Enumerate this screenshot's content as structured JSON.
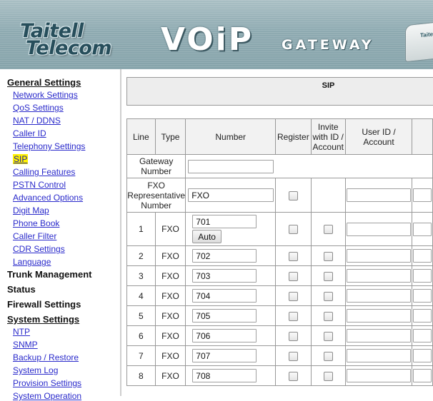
{
  "banner": {
    "logo_line1": "Taitell",
    "logo_line2": "Telecom",
    "product_voip": "VOiP",
    "product_gateway": "GATEWAY",
    "device_label": "Taitell"
  },
  "sidebar": {
    "general_settings": "General Settings",
    "general_items": [
      {
        "label": "Network Settings"
      },
      {
        "label": "QoS Settings"
      },
      {
        "label": "NAT / DDNS"
      },
      {
        "label": "Caller ID"
      },
      {
        "label": "Telephony Settings"
      },
      {
        "label": "SIP",
        "active": true
      },
      {
        "label": "Calling Features"
      },
      {
        "label": "PSTN Control"
      },
      {
        "label": "Advanced Options"
      },
      {
        "label": "Digit Map"
      },
      {
        "label": "Phone Book"
      },
      {
        "label": "Caller Filter"
      },
      {
        "label": "CDR Settings"
      },
      {
        "label": "Language"
      }
    ],
    "trunk_management": "Trunk Management",
    "status": "Status",
    "firewall_settings": "Firewall Settings",
    "system_settings": "System Settings",
    "system_items": [
      {
        "label": "NTP"
      },
      {
        "label": "SNMP"
      },
      {
        "label": "Backup / Restore"
      },
      {
        "label": "System Log"
      },
      {
        "label": "Provision Settings"
      },
      {
        "label": "System Operation"
      }
    ]
  },
  "main": {
    "section_title": "SIP",
    "table": {
      "headers": {
        "line": "Line",
        "type": "Type",
        "number": "Number",
        "register": "Register",
        "invite_line1": "Invite",
        "invite_line2": "with ID /",
        "invite_line3": "Account",
        "userid_line1": "User ID /",
        "userid_line2": "Account"
      },
      "gateway_number_label_1": "Gateway",
      "gateway_number_label_2": "Number",
      "gateway_number_value": "",
      "fxo_rep_label_1": "FXO",
      "fxo_rep_label_2": "Representative",
      "fxo_rep_label_3": "Number",
      "fxo_rep_value": "FXO",
      "auto_button": "Auto",
      "rows": [
        {
          "line": "1",
          "type": "FXO",
          "number": "701"
        },
        {
          "line": "2",
          "type": "FXO",
          "number": "702"
        },
        {
          "line": "3",
          "type": "FXO",
          "number": "703"
        },
        {
          "line": "4",
          "type": "FXO",
          "number": "704"
        },
        {
          "line": "5",
          "type": "FXO",
          "number": "705"
        },
        {
          "line": "6",
          "type": "FXO",
          "number": "706"
        },
        {
          "line": "7",
          "type": "FXO",
          "number": "707"
        },
        {
          "line": "8",
          "type": "FXO",
          "number": "708"
        }
      ]
    }
  }
}
